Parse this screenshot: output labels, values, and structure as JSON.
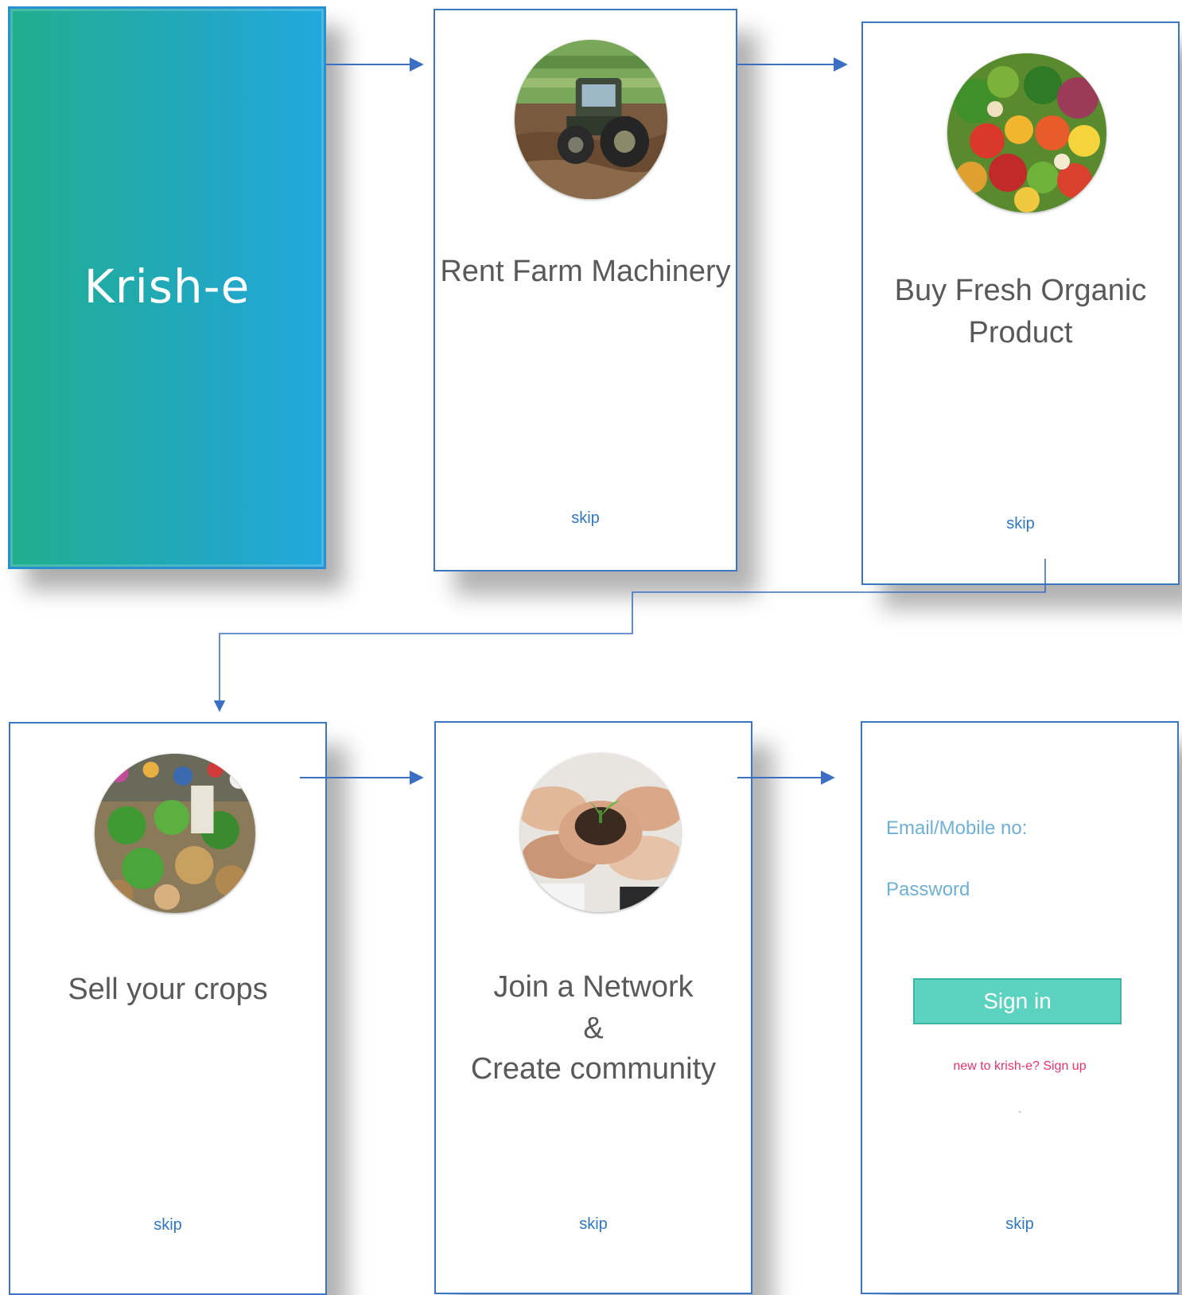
{
  "screens": {
    "splash": {
      "brand": "Krish-e"
    },
    "rent": {
      "title": "Rent Farm Machinery",
      "skip": "skip",
      "image_icon": "tractor-image"
    },
    "buy": {
      "title_line1": "Buy Fresh Organic",
      "title_line2": "Product",
      "skip": "skip",
      "image_icon": "vegetables-image"
    },
    "sell": {
      "title": "Sell your crops",
      "skip": "skip",
      "image_icon": "market-image"
    },
    "network": {
      "title_line1": "Join a Network",
      "title_line2": "&",
      "title_line3": "Create community",
      "skip": "skip",
      "image_icon": "hands-seedling-image"
    },
    "login": {
      "email_label": "Email/Mobile no:",
      "password_label": "Password",
      "signin_label": "Sign in",
      "signup_text": "new to krish-e? Sign up",
      "dash": "-",
      "skip": "skip"
    }
  },
  "colors": {
    "frame_border": "#3a76c4",
    "splash_gradient_start": "#1fae8e",
    "splash_gradient_end": "#22a9dd",
    "title_text": "#595959",
    "skip_link": "#2f77c0",
    "field_label": "#6fb0d6",
    "signin_button": "#5cd3c0",
    "signup_link": "#e6336b"
  }
}
